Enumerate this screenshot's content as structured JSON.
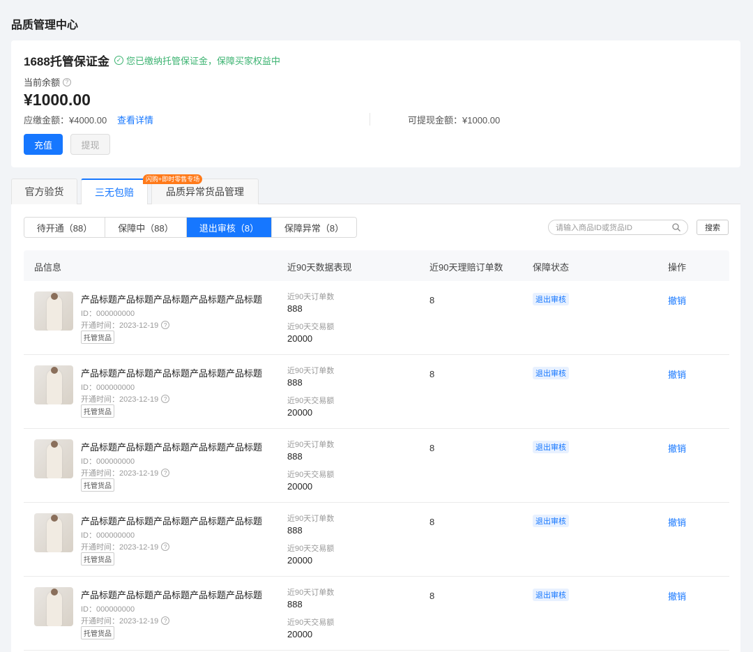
{
  "page_title": "品质管理中心",
  "deposit": {
    "title": "1688托管保证金",
    "status_text": "您已缴纳托管保证金，保障买家权益中",
    "balance_label": "当前余额",
    "balance": "¥1000.00",
    "due_text": "应缴金额：¥4000.00",
    "detail_link": "查看详情",
    "withdrawable_text": "可提现金额：¥1000.00",
    "recharge_label": "充值",
    "withdraw_label": "提现"
  },
  "tabs": [
    {
      "label": "官方验货"
    },
    {
      "label": "三无包赔"
    },
    {
      "label": "品质异常货品管理"
    }
  ],
  "tab_badge": "闪购+即时零售专场",
  "subtabs": [
    {
      "label": "待开通（88）"
    },
    {
      "label": "保障中（88）"
    },
    {
      "label": "退出审核（8）"
    },
    {
      "label": "保障异常（8）"
    }
  ],
  "search": {
    "placeholder": "请输入商品ID或货品ID",
    "button": "搜索"
  },
  "table": {
    "headers": [
      "品信息",
      "近90天数据表现",
      "近90天理赔订单数",
      "保障状态",
      "操作"
    ],
    "rows": [
      {
        "title": "产品标题产品标题产品标题产品标题产品标题",
        "id": "ID：000000000",
        "open": "开通时间：2023-12-19",
        "tag": "托管货品",
        "orders_label": "近90天订单数",
        "orders": "888",
        "amount_label": "近90天交易额",
        "amount": "20000",
        "claims": "8",
        "status": "退出审核",
        "action": "撤销"
      },
      {
        "title": "产品标题产品标题产品标题产品标题产品标题",
        "id": "ID：000000000",
        "open": "开通时间：2023-12-19",
        "tag": "托管货品",
        "orders_label": "近90天订单数",
        "orders": "888",
        "amount_label": "近90天交易额",
        "amount": "20000",
        "claims": "8",
        "status": "退出审核",
        "action": "撤销"
      },
      {
        "title": "产品标题产品标题产品标题产品标题产品标题",
        "id": "ID：000000000",
        "open": "开通时间：2023-12-19",
        "tag": "托管货品",
        "orders_label": "近90天订单数",
        "orders": "888",
        "amount_label": "近90天交易额",
        "amount": "20000",
        "claims": "8",
        "status": "退出审核",
        "action": "撤销"
      },
      {
        "title": "产品标题产品标题产品标题产品标题产品标题",
        "id": "ID：000000000",
        "open": "开通时间：2023-12-19",
        "tag": "托管货品",
        "orders_label": "近90天订单数",
        "orders": "888",
        "amount_label": "近90天交易额",
        "amount": "20000",
        "claims": "8",
        "status": "退出审核",
        "action": "撤销"
      },
      {
        "title": "产品标题产品标题产品标题产品标题产品标题",
        "id": "ID：000000000",
        "open": "开通时间：2023-12-19",
        "tag": "托管货品",
        "orders_label": "近90天订单数",
        "orders": "888",
        "amount_label": "近90天交易额",
        "amount": "20000",
        "claims": "8",
        "status": "退出审核",
        "action": "撤销"
      }
    ]
  }
}
